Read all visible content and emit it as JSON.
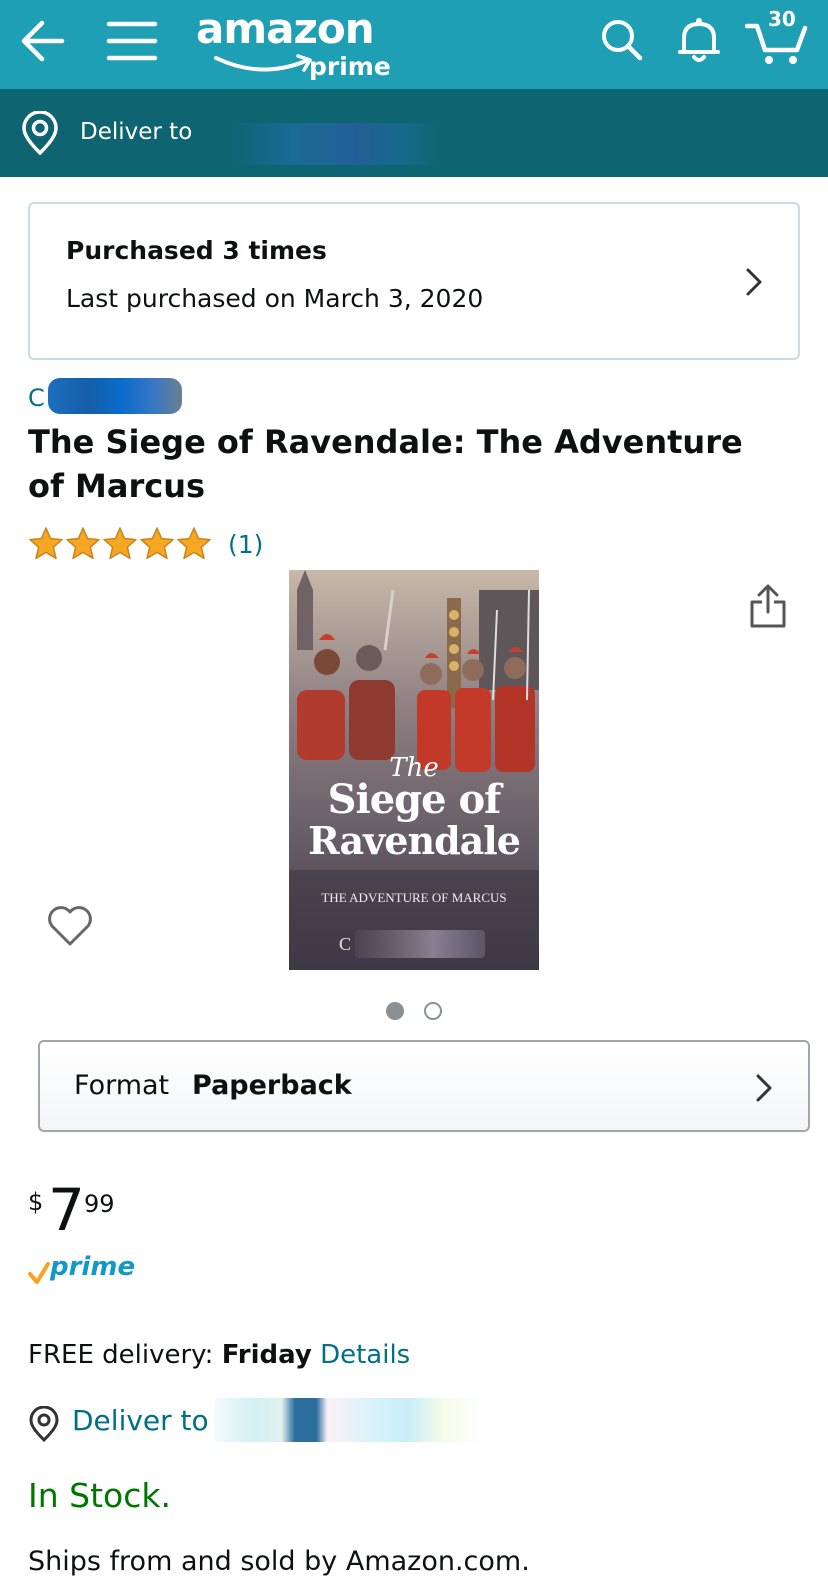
{
  "header": {
    "logo_word": "amazon",
    "logo_sub": "prime",
    "cart_count": "30",
    "deliver_label": "Deliver to"
  },
  "purchase_history": {
    "title": "Purchased 3 times",
    "subtitle": "Last purchased on March 3, 2020"
  },
  "product": {
    "author_initial": "C",
    "title": "The Siege of Ravendale: The Adventure of Marcus",
    "rating": 5,
    "rating_count": "(1)",
    "cover": {
      "the": "The",
      "line1": "Siege of",
      "line2": "Ravendale",
      "subtitle": "THE ADVENTURE OF MARCUS",
      "author_initial": "C"
    },
    "image_count": 2,
    "image_selected": 1
  },
  "format": {
    "label": "Format",
    "value": "Paperback"
  },
  "price": {
    "currency": "$",
    "dollars": "7",
    "cents": "99",
    "prime": "prime"
  },
  "delivery": {
    "prefix": "FREE delivery:",
    "day": "Friday",
    "link": "Details",
    "deliver_label": "Deliver to"
  },
  "stock": "In Stock.",
  "ships": "Ships from and sold by Amazon.com.",
  "colors": {
    "header": "#1f9fb4",
    "deliver_bar": "#0f6471",
    "link": "#007185",
    "in_stock": "#007600",
    "star": "#f5a623"
  }
}
